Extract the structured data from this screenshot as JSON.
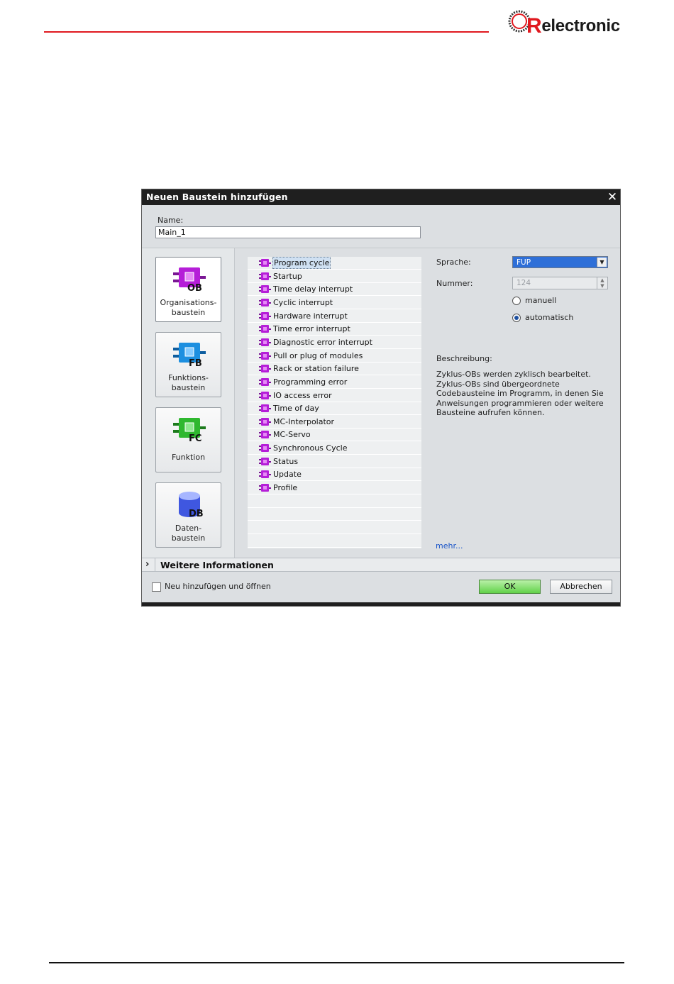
{
  "header": {
    "logo_text": "electronic",
    "logo_letter": "R"
  },
  "dialog": {
    "title": "Neuen Baustein hinzufügen",
    "close_glyph": "✕",
    "name_label": "Name:",
    "name_value": "Main_1",
    "block_types": [
      {
        "badge": "OB",
        "label_line1": "Organisations-",
        "label_line2": "baustein",
        "color": "#b51ed8",
        "selected": true
      },
      {
        "badge": "FB",
        "label_line1": "Funktions-",
        "label_line2": "baustein",
        "color": "#1d8fe0",
        "selected": false
      },
      {
        "badge": "FC",
        "label_line1": "Funktion",
        "label_line2": "",
        "color": "#2fb82f",
        "selected": false
      },
      {
        "badge": "DB",
        "label_line1": "Daten-",
        "label_line2": "baustein",
        "color": "#3f57e0",
        "selected": false
      }
    ],
    "ob_list": [
      "Program cycle",
      "Startup",
      "Time delay interrupt",
      "Cyclic interrupt",
      "Hardware interrupt",
      "Time error interrupt",
      "Diagnostic error interrupt",
      "Pull or plug of modules",
      "Rack or station failure",
      "Programming error",
      "IO access error",
      "Time of day",
      "MC-Interpolator",
      "MC-Servo",
      "Synchronous Cycle",
      "Status",
      "Update",
      "Profile"
    ],
    "selected_ob": "Program cycle",
    "language_label": "Sprache:",
    "language_value": "FUP",
    "number_label": "Nummer:",
    "number_value": "124",
    "radio_manual": "manuell",
    "radio_auto": "automatisch",
    "radio_selected": "automatisch",
    "description_label": "Beschreibung:",
    "description_text": "Zyklus-OBs werden zyklisch bearbeitet. Zyklus-OBs sind übergeordnete Codebausteine im Programm, in denen Sie Anweisungen programmieren oder weitere Bausteine aufrufen können.",
    "more_link": "mehr...",
    "more_info_chevron": "›",
    "more_info_label": "Weitere Informationen",
    "add_open_label": "Neu hinzufügen und öffnen",
    "add_open_checked": false,
    "ok_label": "OK",
    "cancel_label": "Abbrechen"
  },
  "colors": {
    "accent_red": "#e0191f",
    "ok_green": "#62d24a",
    "select_blue": "#2e6fd8",
    "ob_purple": "#b51ed8"
  }
}
